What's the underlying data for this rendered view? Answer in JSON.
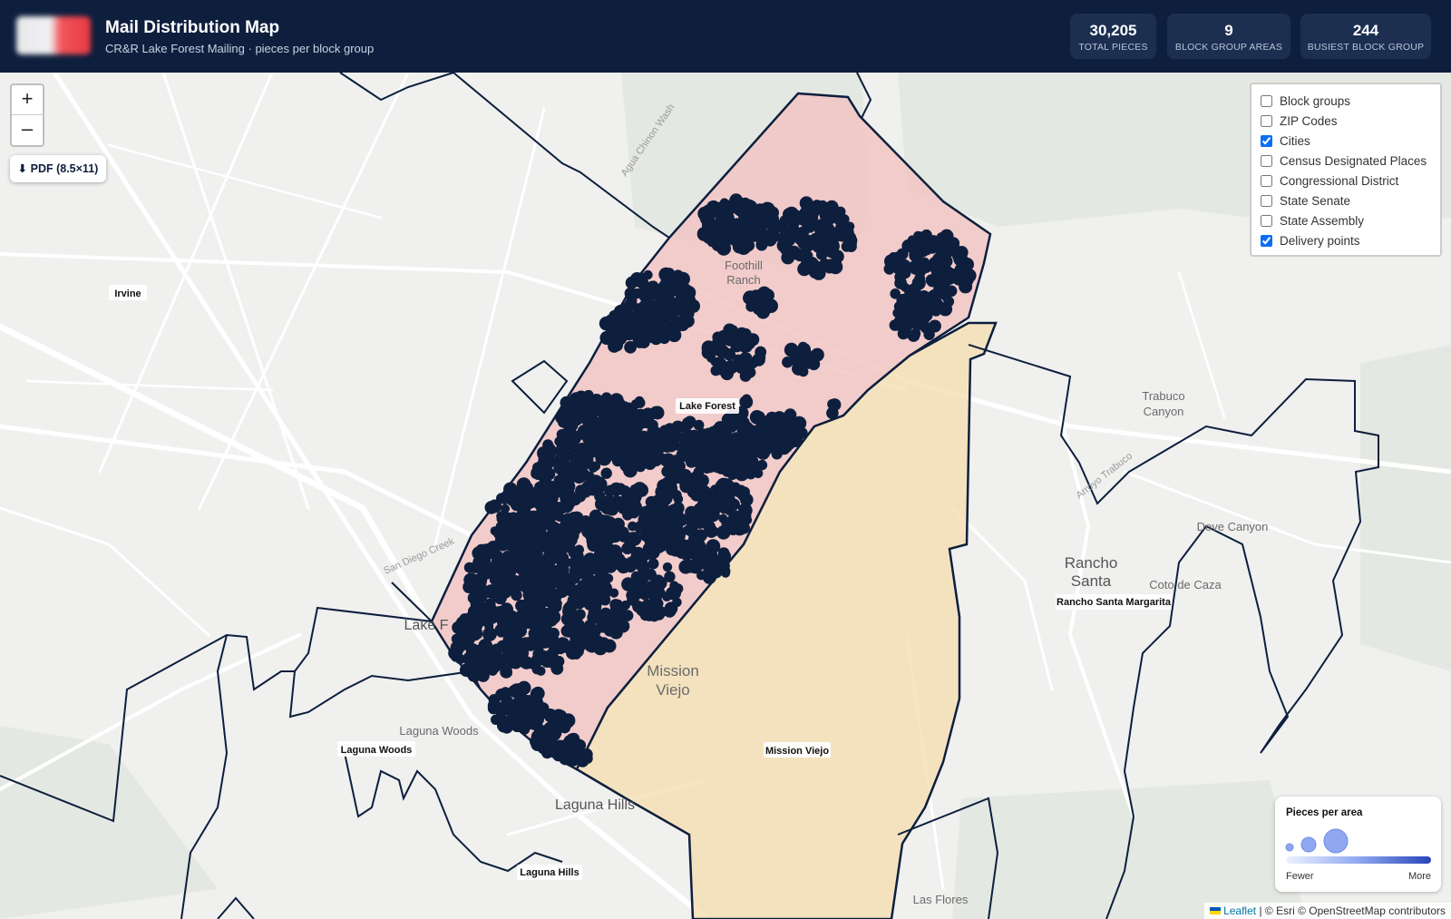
{
  "header": {
    "title": "Mail Distribution Map",
    "subtitle": "CR&R Lake Forest Mailing · pieces per block group",
    "stats": [
      {
        "value": "30,205",
        "label": "TOTAL PIECES"
      },
      {
        "value": "9",
        "label": "BLOCK GROUP AREAS"
      },
      {
        "value": "244",
        "label": "BUSIEST BLOCK GROUP"
      }
    ]
  },
  "controls": {
    "zoom_in": "+",
    "zoom_out": "–",
    "pdf_button": "⬇ PDF (8.5×11)"
  },
  "layers": [
    {
      "label": "Block groups",
      "checked": false
    },
    {
      "label": "ZIP Codes",
      "checked": false
    },
    {
      "label": "Cities",
      "checked": true
    },
    {
      "label": "Census Designated Places",
      "checked": false
    },
    {
      "label": "Congressional District",
      "checked": false
    },
    {
      "label": "State Senate",
      "checked": false
    },
    {
      "label": "State Assembly",
      "checked": false
    },
    {
      "label": "Delivery points",
      "checked": true
    }
  ],
  "legend": {
    "title": "Pieces per area",
    "low": "Fewer",
    "high": "More"
  },
  "attribution": {
    "leaflet": "Leaflet",
    "rest": " | © Esri © OpenStreetMap contributors"
  },
  "map": {
    "city_labels": {
      "irvine": "Irvine",
      "lake_forest": "Lake Forest",
      "mission_viejo": "Mission Viejo",
      "laguna_woods": "Laguna Woods",
      "laguna_hills": "Laguna Hills",
      "rancho_santa_margarita": "Rancho Santa Margarita"
    },
    "basemap_labels": {
      "foothill_ranch": [
        "Foothill",
        "Ranch"
      ],
      "mission_viejo": [
        "Mission",
        "Viejo"
      ],
      "rancho_santa": [
        "Rancho",
        "Santa"
      ],
      "trabuco_canyon": [
        "Trabuco",
        "Canyon"
      ],
      "dove_canyon": "Dove Canyon",
      "coto_de_caza": "Coto de Caza",
      "laguna_woods": "Laguna Woods",
      "laguna_hills": "Laguna Hills",
      "lake_f": "Lake F",
      "las_flores": "Las Flores",
      "agua_chinon_wash": "Agua Chinon Wash",
      "san_diego_creek": "San Diego Creek",
      "arroyo_trabuco": "Arroyo Trabuco"
    },
    "colors": {
      "lake_forest_fill": "#f2c4c4",
      "mission_viejo_fill": "#f5deb3",
      "boundary": "#0d1f3d",
      "delivery_points": "#0d1f3d"
    }
  }
}
